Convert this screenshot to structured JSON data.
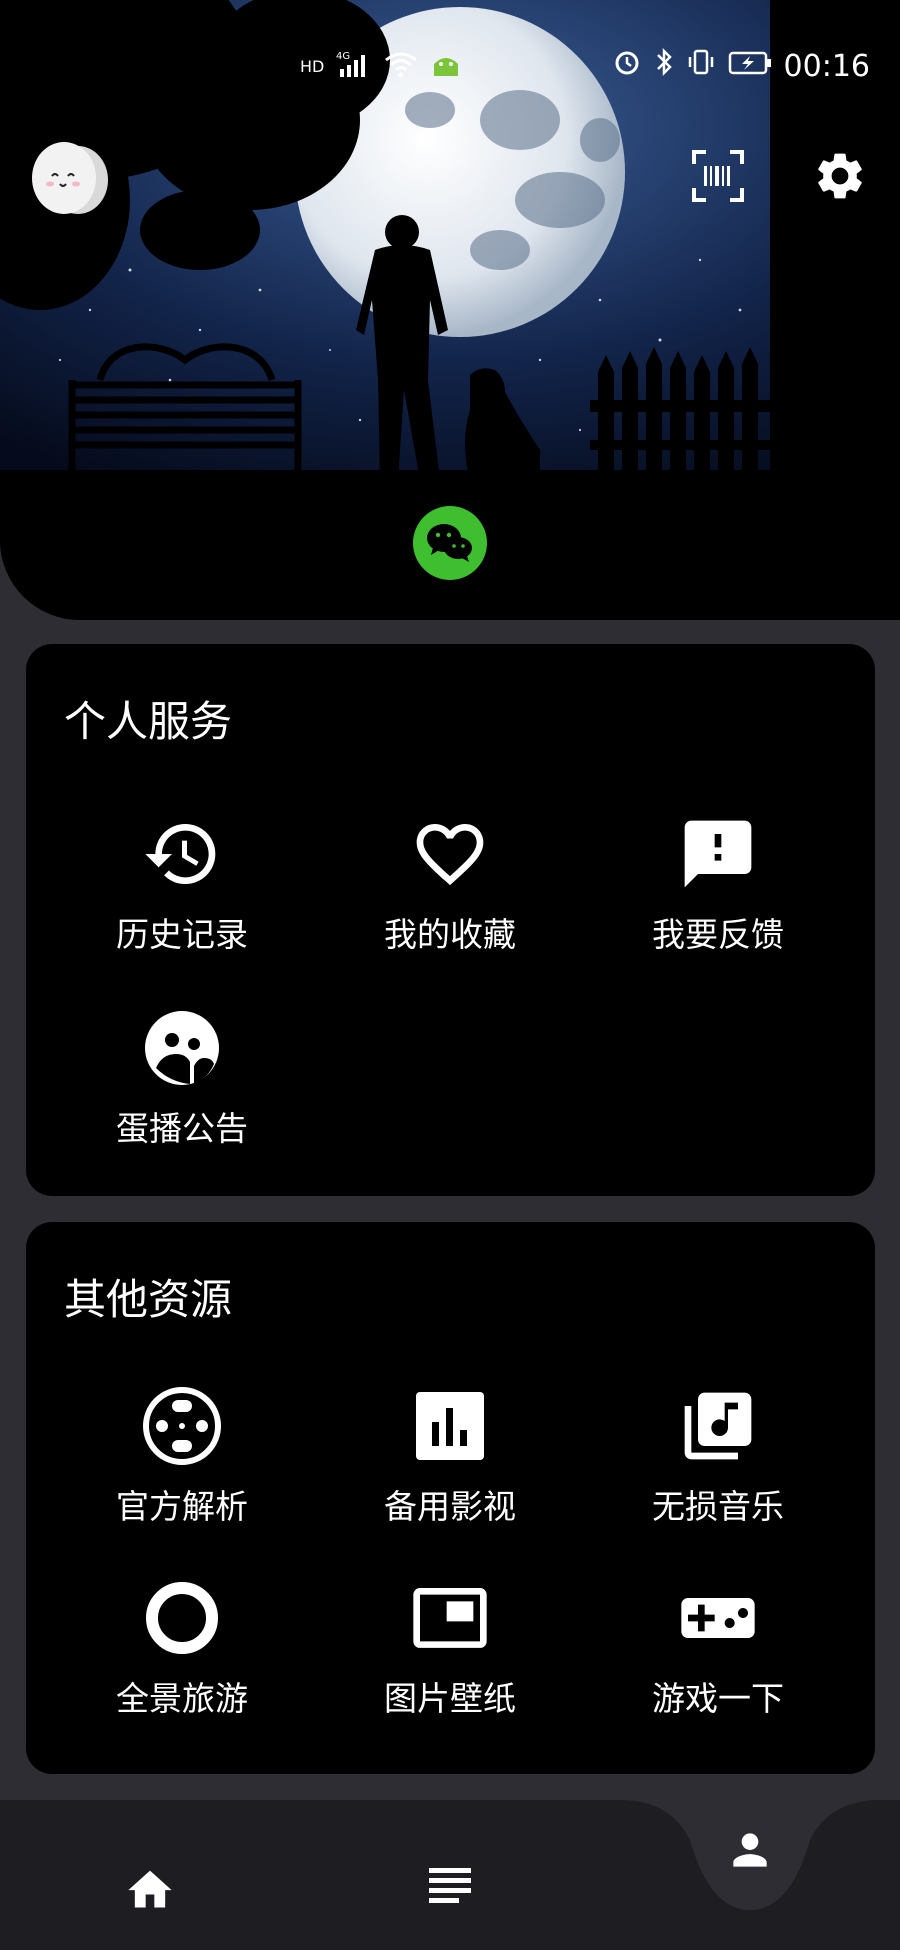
{
  "status_bar": {
    "hd_label": "HD",
    "network_label": "4G",
    "time": "00:16",
    "icons": [
      "signal-icon",
      "wifi-icon",
      "android-icon",
      "alarm-icon",
      "bluetooth-icon",
      "vibrate-icon",
      "battery-icon"
    ]
  },
  "header": {
    "avatar_icon": "egg-avatar",
    "scan_icon": "scan-barcode-icon",
    "settings_icon": "gear-icon",
    "wechat_icon": "wechat-icon"
  },
  "personal_services": {
    "title": "个人服务",
    "items": [
      {
        "label": "历史记录",
        "icon": "history-icon"
      },
      {
        "label": "我的收藏",
        "icon": "heart-icon"
      },
      {
        "label": "我要反馈",
        "icon": "feedback-icon"
      },
      {
        "label": "蛋播公告",
        "icon": "announcement-icon"
      }
    ]
  },
  "other_resources": {
    "title": "其他资源",
    "items": [
      {
        "label": "官方解析",
        "icon": "film-reel-icon"
      },
      {
        "label": "备用影视",
        "icon": "bar-chart-icon"
      },
      {
        "label": "无损音乐",
        "icon": "music-library-icon"
      },
      {
        "label": "全景旅游",
        "icon": "ring-icon"
      },
      {
        "label": "图片壁纸",
        "icon": "picture-in-picture-icon"
      },
      {
        "label": "游戏一下",
        "icon": "gamepad-icon"
      }
    ]
  },
  "bottom_nav": {
    "items": [
      "home-icon",
      "list-icon",
      "person-icon"
    ],
    "active": "person-icon"
  },
  "colors": {
    "page_bg": "#2e2d33",
    "card_bg": "#000000",
    "wechat_green": "#3fbf2f"
  }
}
